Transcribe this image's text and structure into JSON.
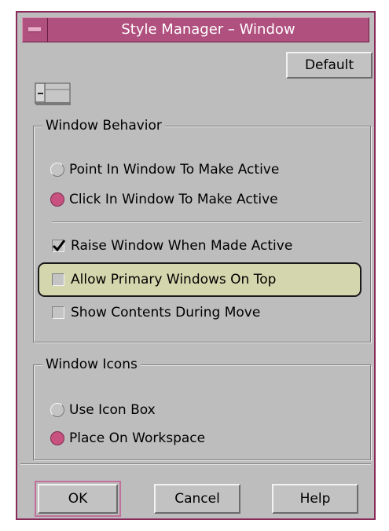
{
  "window": {
    "title": "Style Manager – Window",
    "menu_icon": "window-menu-icon"
  },
  "toolbar": {
    "default_label": "Default",
    "preview_icon": "window-preview-icon"
  },
  "behavior": {
    "legend": "Window Behavior",
    "focus_options": [
      {
        "label": "Point In Window To Make Active",
        "selected": false
      },
      {
        "label": "Click In Window To Make Active",
        "selected": true
      }
    ],
    "checkboxes": [
      {
        "label": "Raise Window When Made Active",
        "checked": true
      },
      {
        "label": "Allow Primary Windows On Top",
        "checked": false,
        "highlighted": true
      },
      {
        "label": "Show Contents During Move",
        "checked": false
      }
    ]
  },
  "icons": {
    "legend": "Window Icons",
    "options": [
      {
        "label": "Use Icon Box",
        "selected": false
      },
      {
        "label": "Place On Workspace",
        "selected": true
      }
    ]
  },
  "footer": {
    "ok_label": "OK",
    "cancel_label": "Cancel",
    "help_label": "Help"
  },
  "colors": {
    "accent": "#b0507e",
    "radio_selected": "#c8527f",
    "panel": "#bdbdbd",
    "highlight": "#e8eba0"
  }
}
